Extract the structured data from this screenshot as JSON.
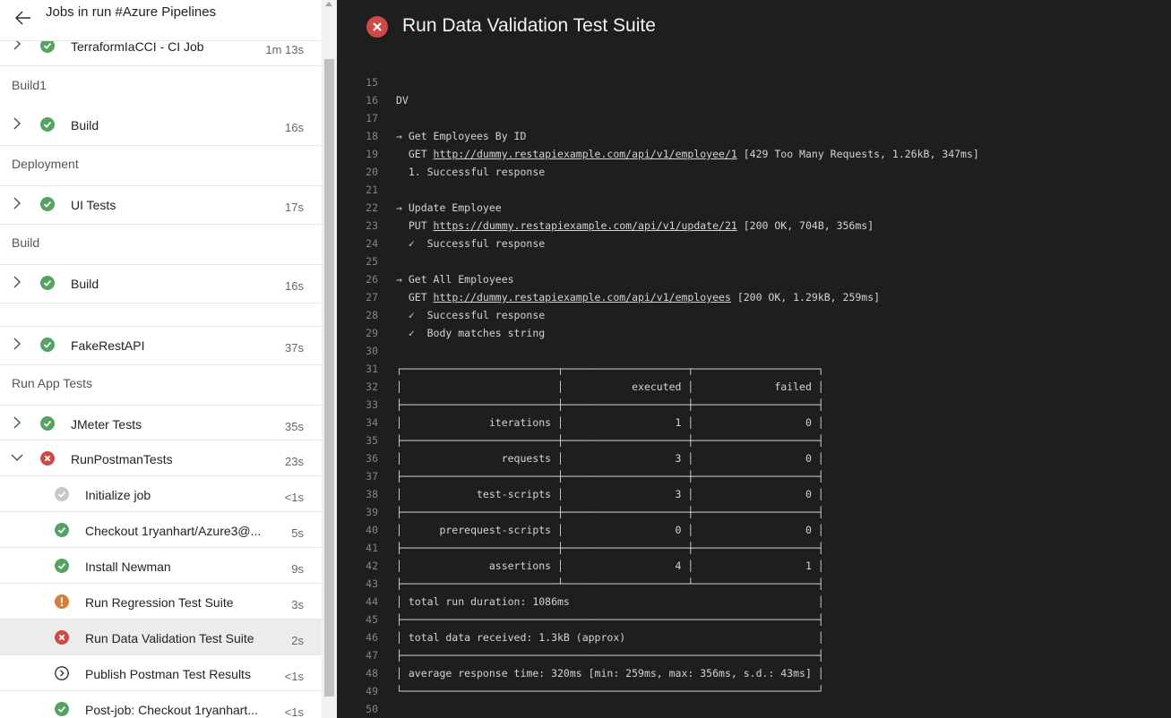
{
  "left_panel": {
    "title": "Jobs in run #Azure Pipelines",
    "back_icon": "arrow-left-icon",
    "stages": [
      {
        "label": ""
      },
      {
        "label": "Build1"
      },
      {
        "label": "Deployment"
      },
      {
        "label": "Build"
      },
      {
        "label": ""
      },
      {
        "label": "Run App Tests"
      }
    ],
    "jobs": [
      {
        "name": "TerraformIaCCI - CI Job",
        "duration": "1m 13s",
        "status": "succeeded",
        "expanded": false
      },
      {
        "name": "Build",
        "duration": "16s",
        "status": "succeeded",
        "expanded": false
      },
      {
        "name": "UI Tests",
        "duration": "17s",
        "status": "succeeded",
        "expanded": false
      },
      {
        "name": "Build",
        "duration": "16s",
        "status": "succeeded",
        "expanded": false
      },
      {
        "name": "FakeRestAPI",
        "duration": "37s",
        "status": "succeeded",
        "expanded": false
      },
      {
        "name": "JMeter Tests",
        "duration": "35s",
        "status": "succeeded",
        "expanded": false
      },
      {
        "name": "RunPostmanTests",
        "duration": "23s",
        "status": "failed",
        "expanded": true
      }
    ],
    "steps": [
      {
        "name": "Initialize job",
        "duration": "<1s",
        "status": "skipped"
      },
      {
        "name": "Checkout 1ryanhart/Azure3@...",
        "duration": "5s",
        "status": "succeeded"
      },
      {
        "name": "Install Newman",
        "duration": "9s",
        "status": "succeeded"
      },
      {
        "name": "Run Regression Test Suite",
        "duration": "3s",
        "status": "warning"
      },
      {
        "name": "Run Data Validation Test Suite",
        "duration": "2s",
        "status": "failed",
        "selected": true
      },
      {
        "name": "Publish Postman Test Results",
        "duration": "<1s",
        "status": "pending"
      },
      {
        "name": "Post-job: Checkout 1ryanhart...",
        "duration": "<1s",
        "status": "succeeded"
      }
    ]
  },
  "right_panel": {
    "title": "Run Data Validation Test Suite",
    "status": "failed",
    "status_icon": "error-circle-icon"
  },
  "log_lines": [
    {
      "n": "15",
      "t": ""
    },
    {
      "n": "16",
      "t": "DV"
    },
    {
      "n": "17",
      "t": ""
    },
    {
      "n": "18",
      "t": "→ Get Employees By ID"
    },
    {
      "n": "19",
      "t": "  GET ",
      "link": "http://dummy.restapiexample.com/api/v1/employee/1",
      "after": " [429 Too Many Requests, 1.26kB, 347ms]"
    },
    {
      "n": "20",
      "t": "  1. Successful response"
    },
    {
      "n": "21",
      "t": ""
    },
    {
      "n": "22",
      "t": "→ Update Employee"
    },
    {
      "n": "23",
      "t": "  PUT ",
      "link": "https://dummy.restapiexample.com/api/v1/update/21",
      "after": " [200 OK, 704B, 356ms]"
    },
    {
      "n": "24",
      "t": "  ✓  Successful response"
    },
    {
      "n": "25",
      "t": ""
    },
    {
      "n": "26",
      "t": "→ Get All Employees"
    },
    {
      "n": "27",
      "t": "  GET ",
      "link": "http://dummy.restapiexample.com/api/v1/employees",
      "after": " [200 OK, 1.29kB, 259ms]"
    },
    {
      "n": "28",
      "t": "  ✓  Successful response"
    },
    {
      "n": "29",
      "t": "  ✓  Body matches string"
    },
    {
      "n": "30",
      "t": ""
    },
    {
      "n": "31",
      "t": "┌─────────────────────────┬────────────────────┬────────────────────┐"
    },
    {
      "n": "32",
      "t": "│                         │           executed │             failed │"
    },
    {
      "n": "33",
      "t": "├─────────────────────────┼────────────────────┼────────────────────┤"
    },
    {
      "n": "34",
      "t": "│              iterations │                  1 │                  0 │"
    },
    {
      "n": "35",
      "t": "├─────────────────────────┼────────────────────┼────────────────────┤"
    },
    {
      "n": "36",
      "t": "│                requests │                  3 │                  0 │"
    },
    {
      "n": "37",
      "t": "├─────────────────────────┼────────────────────┼────────────────────┤"
    },
    {
      "n": "38",
      "t": "│            test-scripts │                  3 │                  0 │"
    },
    {
      "n": "39",
      "t": "├─────────────────────────┼────────────────────┼────────────────────┤"
    },
    {
      "n": "40",
      "t": "│      prerequest-scripts │                  0 │                  0 │"
    },
    {
      "n": "41",
      "t": "├─────────────────────────┼────────────────────┼────────────────────┤"
    },
    {
      "n": "42",
      "t": "│              assertions │                  4 │                  1 │"
    },
    {
      "n": "43",
      "t": "├─────────────────────────┴────────────────────┴────────────────────┤"
    },
    {
      "n": "44",
      "t": "│ total run duration: 1086ms                                        │"
    },
    {
      "n": "45",
      "t": "├───────────────────────────────────────────────────────────────────┤"
    },
    {
      "n": "46",
      "t": "│ total data received: 1.3kB (approx)                               │"
    },
    {
      "n": "47",
      "t": "├───────────────────────────────────────────────────────────────────┤"
    },
    {
      "n": "48",
      "t": "│ average response time: 320ms [min: 259ms, max: 356ms, s.d.: 43ms] │"
    },
    {
      "n": "49",
      "t": "└───────────────────────────────────────────────────────────────────┘"
    },
    {
      "n": "50",
      "t": ""
    }
  ],
  "colors": {
    "succeeded": "#55a362",
    "failed": "#cd4a45",
    "warning": "#d67f3c",
    "skipped": "#c8c8c8",
    "pending": "#333333"
  }
}
